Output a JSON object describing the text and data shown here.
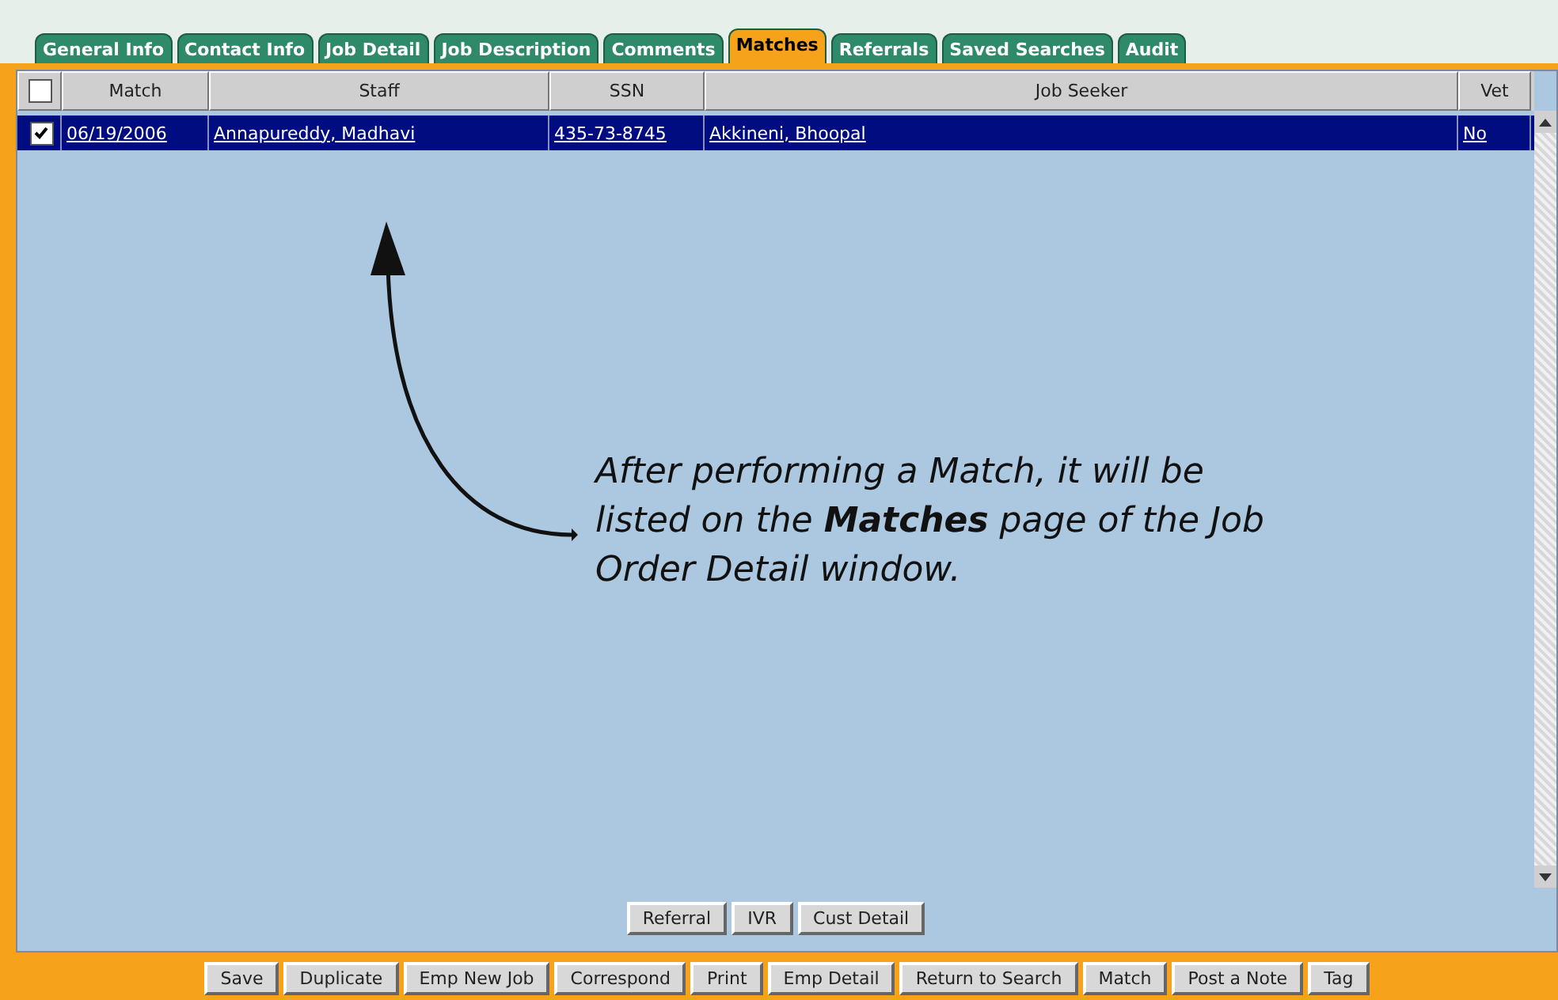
{
  "tabs": [
    {
      "label": "General Info",
      "selected": false
    },
    {
      "label": "Contact Info",
      "selected": false
    },
    {
      "label": "Job Detail",
      "selected": false
    },
    {
      "label": "Job Description",
      "selected": false
    },
    {
      "label": "Comments",
      "selected": false
    },
    {
      "label": "Matches",
      "selected": true
    },
    {
      "label": "Referrals",
      "selected": false
    },
    {
      "label": "Saved Searches",
      "selected": false
    },
    {
      "label": "Audit",
      "selected": false
    }
  ],
  "table": {
    "header_checked": false,
    "columns": [
      "Match",
      "Staff",
      "SSN",
      "Job Seeker",
      "Vet"
    ],
    "rows": [
      {
        "checked": true,
        "selected": true,
        "cells": [
          "06/19/2006",
          "Annapureddy, Madhavi",
          "435-73-8745",
          "Akkineni, Bhoopal",
          "No"
        ]
      }
    ]
  },
  "annotation": "After performing a Match, it will be listed on the **Matches** page of the Job Order Detail window.",
  "detail_buttons": [
    "Referral",
    "IVR",
    "Cust Detail"
  ],
  "toolbar_buttons": [
    "Save",
    "Duplicate",
    "Emp New Job",
    "Correspond",
    "Print",
    "Emp Detail",
    "Return to Search",
    "Match",
    "Post a Note",
    "Tag"
  ]
}
